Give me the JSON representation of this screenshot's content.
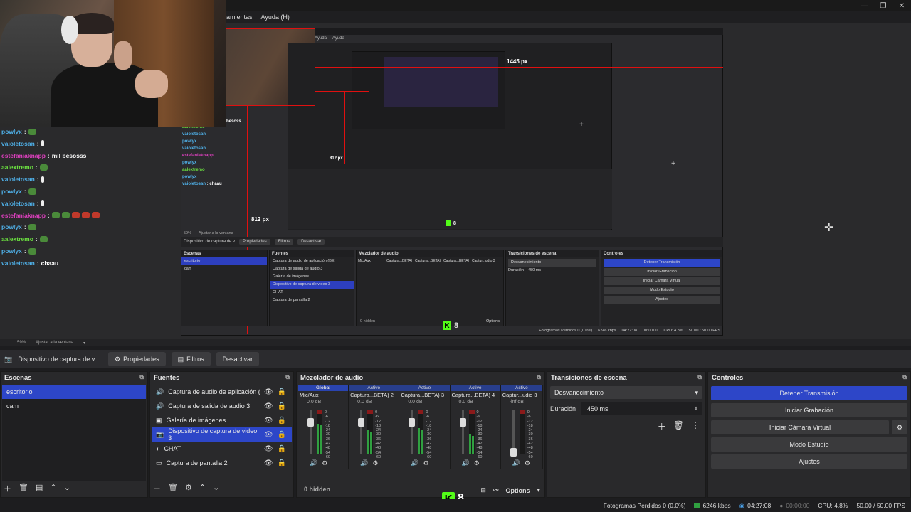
{
  "menu": {
    "tools": "amientas",
    "help": "Ayuda (H)"
  },
  "nested_menu": [
    "Ayuda",
    "Ayuda"
  ],
  "measures": {
    "width_label": "1445 px",
    "height_label_a": "812 px",
    "height_label_b": "812 px"
  },
  "chat": [
    {
      "user": "powlyx",
      "color": "#4fb0e8",
      "msg": "",
      "emotes": [
        "green"
      ]
    },
    {
      "user": "vaioletosan",
      "color": "#4fb0e8",
      "msg": "",
      "emotes": [
        "bang"
      ]
    },
    {
      "user": "estefaniaknapp",
      "color": "#e040c0",
      "msg": "mil besosss",
      "emotes": []
    },
    {
      "user": "aalextremo",
      "color": "#6be040",
      "msg": "",
      "emotes": [
        "green"
      ]
    },
    {
      "user": "vaioletosan",
      "color": "#4fb0e8",
      "msg": "",
      "emotes": [
        "bang"
      ]
    },
    {
      "user": "powlyx",
      "color": "#4fb0e8",
      "msg": "",
      "emotes": [
        "green"
      ]
    },
    {
      "user": "vaioletosan",
      "color": "#4fb0e8",
      "msg": "",
      "emotes": [
        "bang"
      ]
    },
    {
      "user": "estefaniaknapp",
      "color": "#e040c0",
      "msg": "",
      "emotes": [
        "green",
        "green",
        "red",
        "red",
        "red"
      ]
    },
    {
      "user": "powlyx",
      "color": "#4fb0e8",
      "msg": "",
      "emotes": [
        "green"
      ]
    },
    {
      "user": "aalextremo",
      "color": "#6be040",
      "msg": "",
      "emotes": [
        "green"
      ]
    },
    {
      "user": "powlyx",
      "color": "#4fb0e8",
      "msg": "",
      "emotes": [
        "green"
      ]
    },
    {
      "user": "vaioletosan",
      "color": "#4fb0e8",
      "msg": "chaau",
      "emotes": []
    }
  ],
  "nested_chat": [
    {
      "user": "aalextremo",
      "color": "#6be040",
      "msg": ""
    },
    {
      "user": "vaioletosan",
      "color": "#4fb0e8",
      "msg": ""
    },
    {
      "user": "powlyx",
      "color": "#4fb0e8",
      "msg": ""
    },
    {
      "user": "vaioletosan",
      "color": "#4fb0e8",
      "msg": ""
    },
    {
      "user": "estefaniaknapp",
      "color": "#e040c0",
      "msg": ""
    },
    {
      "user": "powlyx",
      "color": "#4fb0e8",
      "msg": ""
    },
    {
      "user": "aalextremo",
      "color": "#6be040",
      "msg": ""
    },
    {
      "user": "powlyx",
      "color": "#4fb0e8",
      "msg": ""
    },
    {
      "user": "vaioletosan",
      "color": "#4fb0e8",
      "msg": "chaau"
    }
  ],
  "chat_fragment": "besoss",
  "zoom": {
    "level": "59%",
    "fit": "Ajustar a la ventana"
  },
  "nested_zoom": {
    "level": "59%",
    "fit": "Ajustar a la ventana"
  },
  "source_toolbar": {
    "source": "Dispositivo de captura de v",
    "properties": "Propiedades",
    "filters": "Filtros",
    "deactivate": "Desactivar"
  },
  "nested_source_toolbar": {
    "source": "Dispositivo de captura de v",
    "properties": "Propiedades",
    "filters": "Filtros",
    "deactivate": "Desactivar"
  },
  "scenes": {
    "title": "Escenas",
    "items": [
      "escritorio",
      "cam"
    ],
    "selected": 0
  },
  "sources": {
    "title": "Fuentes",
    "items": [
      "Captura de audio de aplicación (BE",
      "Captura de salida de audio 3",
      "Galería de imágenes",
      "Dispositivo de captura de video 3",
      "CHAT",
      "Captura de pantalla 2"
    ],
    "selected": 3
  },
  "nested_sources": [
    "Captura de audio de aplicación (BE",
    "Captura de salida de audio 3",
    "Galería de imágenes",
    "Dispositivo de captura de video 3",
    "CHAT",
    "Captura de pantalla 2"
  ],
  "mixer": {
    "title": "Mezclador de audio",
    "channels": [
      {
        "top": "Global",
        "name": "Mic/Aux",
        "db": "0.0 dB",
        "fader": 0.8,
        "level": 0.7
      },
      {
        "top": "Active",
        "name": "Captura...BETA) 2",
        "db": "0.0 dB",
        "fader": 0.8,
        "level": 0.55
      },
      {
        "top": "Active",
        "name": "Captura...BETA) 3",
        "db": "0.0 dB",
        "fader": 0.8,
        "level": 0.6
      },
      {
        "top": "Active",
        "name": "Captura...BETA) 4",
        "db": "0.0 dB",
        "fader": 0.8,
        "level": 0.45
      },
      {
        "top": "Active",
        "name": "Captur...udio 3",
        "db": "-inf dB",
        "fader": 0.05,
        "level": 0.0
      }
    ],
    "scale": [
      "0",
      "-6",
      "-12",
      "-18",
      "-24",
      "-30",
      "-36",
      "-42",
      "-48",
      "-54",
      "-60"
    ],
    "hidden": "0 hidden",
    "options": "Options"
  },
  "nested_mixer": {
    "channels": [
      "Mic/Aux",
      "Captura...BETA) 2",
      "Captura...BETA) 3",
      "Captura...BETA) 4",
      "Captur...udio 3"
    ],
    "hidden": "0 hidden",
    "options": "Options"
  },
  "transitions": {
    "title": "Transiciones de escena",
    "type": "Desvanecimiento",
    "duration_label": "Duración",
    "duration": "450 ms"
  },
  "controls": {
    "title": "Controles",
    "buttons": [
      "Detener Transmisión",
      "Iniciar Grabación",
      "Iniciar Cámara Virtual",
      "Modo Estudio",
      "Ajustes"
    ]
  },
  "status": {
    "dropped": "Fotogramas Perdidos 0 (0.0%)",
    "bitrate": "6246 kbps",
    "live_time": "04:27:08",
    "rec_time": "00:00:00",
    "cpu": "CPU: 4.8%",
    "fps": "50.00 / 50.00 FPS"
  },
  "nested_status": {
    "dropped": "Fotogramas Perdidos 0 (0.0%)",
    "bitrate": "6246 kbps",
    "live_time": "04:27:08",
    "rec_time": "00:00:00",
    "cpu": "CPU: 4.8%",
    "fps": "50.00 / 50.00 FPS"
  },
  "kick": {
    "count": "8"
  },
  "nested_kick": {
    "count": "8"
  },
  "colors": {
    "accent": "#2d46c8",
    "guide": "#e01010",
    "kick": "#53fc18"
  }
}
